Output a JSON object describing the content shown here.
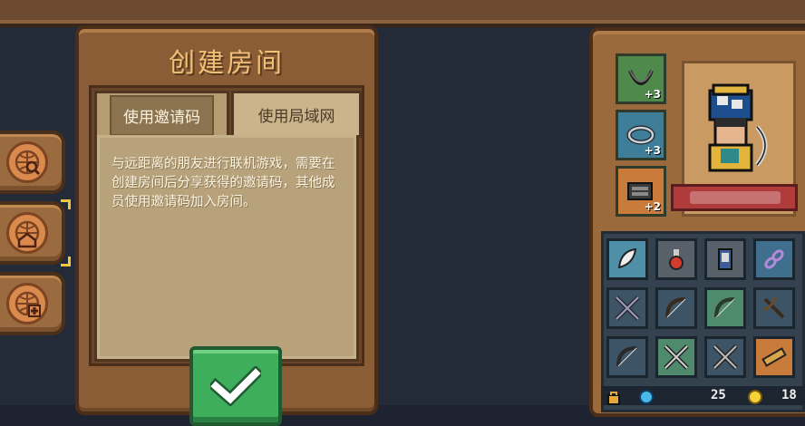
{
  "dialog": {
    "title": "创建房间",
    "tabs": [
      {
        "label": "使用邀请码",
        "selected": true
      },
      {
        "label": "使用局域网",
        "selected": false
      }
    ],
    "description": "与远距离的朋友进行联机游戏，需要在创建房间后分享获得的邀请码，其他成员使用邀请码加入房间。",
    "confirm_icon": "check-icon"
  },
  "side_buttons": [
    {
      "icon": "globe-search-icon"
    },
    {
      "icon": "globe-home-icon",
      "selected": true
    },
    {
      "icon": "globe-plus-icon"
    }
  ],
  "equipment": [
    {
      "icon": "necklace-icon",
      "bonus": "+3"
    },
    {
      "icon": "ring-icon",
      "bonus": "+3"
    },
    {
      "icon": "gauntlet-icon",
      "bonus": "+2"
    }
  ],
  "inventory": [
    "feather-icon",
    "potion-icon",
    "scroll-icon",
    "chain-icon",
    "crossed-daggers-icon",
    "bow-icon",
    "bow-icon",
    "crossbow-icon",
    "bow-icon",
    "crossed-swords-icon",
    "crossed-daggers-icon",
    "telescope-icon"
  ],
  "currency": {
    "gems": "25",
    "gold": "18"
  },
  "colors": {
    "wood": "#8a5d36",
    "parchment": "#b8a27b",
    "confirm_green": "#3fae5c",
    "title_gold": "#f0c078"
  }
}
